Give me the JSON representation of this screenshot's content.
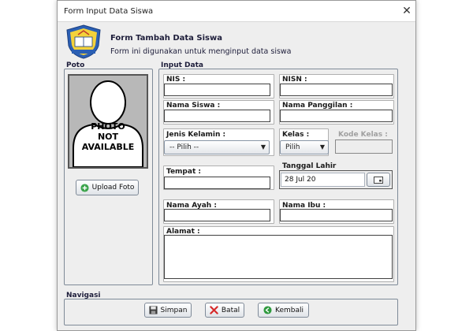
{
  "window": {
    "title": "Form Input Data Siswa"
  },
  "header": {
    "title": "Form Tambah Data Siswa",
    "subtitle": "Form ini digunakan untuk menginput data siswa"
  },
  "photo": {
    "section_label": "Poto",
    "placeholder_lines": [
      "PHOTO",
      "NOT",
      "AVAILABLE"
    ],
    "upload_label": "Upload Foto"
  },
  "input": {
    "section_label": "Input Data",
    "nis_label": "NIS :",
    "nisn_label": "NISN :",
    "nama_siswa_label": "Nama Siswa :",
    "nama_panggilan_label": "Nama Panggilan :",
    "jenis_kelamin_label": "Jenis Kelamin :",
    "jenis_kelamin_value": "-- Pilih --",
    "kelas_label": "Kelas :",
    "kelas_value": "Pilih",
    "kode_kelas_label": "Kode Kelas :",
    "tempat_label": "Tempat :",
    "tanggal_lahir_label": "Tanggal Lahir",
    "tanggal_lahir_value": "28 Jul 20",
    "nama_ayah_label": "Nama Ayah :",
    "nama_ibu_label": "Nama Ibu :",
    "alamat_label": "Alamat :"
  },
  "navigasi": {
    "section_label": "Navigasi",
    "simpan_label": "Simpan",
    "batal_label": "Batal",
    "kembali_label": "Kembali"
  },
  "icons": {
    "close": "close-icon",
    "logo": "school-logo-icon",
    "upload": "add-circle-icon",
    "save": "floppy-disk-icon",
    "cancel": "x-mark-icon",
    "back": "back-arrow-icon",
    "calendar": "calendar-icon"
  },
  "colors": {
    "window_bg": "#eeeeee",
    "group_border": "#7e8a98",
    "header_text": "#1d1d3a"
  }
}
